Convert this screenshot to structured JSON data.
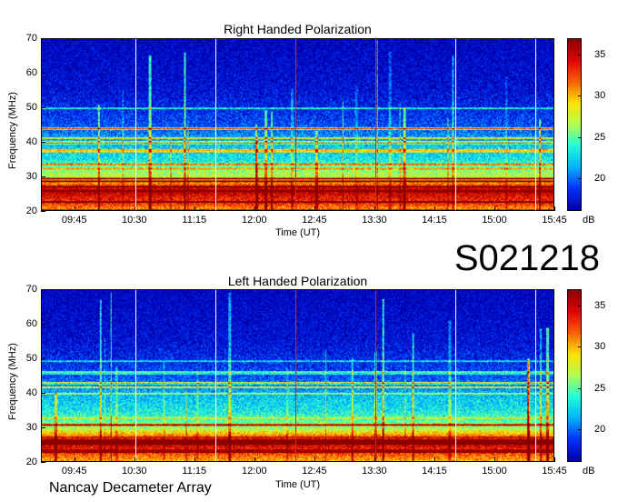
{
  "session_id": "S021218",
  "footer_text": "Nancay Decameter Array",
  "colors": {
    "background_blue": "#0a1f9c",
    "marker_white": "#ffffff",
    "marker_red": "#d12a1a",
    "colormap": [
      "#0000aa",
      "#0030ff",
      "#00b0ff",
      "#20ffd8",
      "#b0ff50",
      "#ffe000",
      "#ff6000",
      "#e00000",
      "#8a0000"
    ]
  },
  "chart_data": [
    {
      "type": "heatmap",
      "title": "Right Handed Polarization",
      "xlabel": "Time (UT)",
      "ylabel": "Frequency (MHz)",
      "xlim": [
        "09:20",
        "15:45"
      ],
      "ylim": [
        20,
        70
      ],
      "x_ticks": [
        "09:45",
        "10:30",
        "11:15",
        "12:00",
        "12:45",
        "13:30",
        "14:15",
        "15:00",
        "15:45"
      ],
      "y_ticks": [
        20,
        30,
        40,
        50,
        60,
        70
      ],
      "colorbar": {
        "unit": "dB",
        "ticks": [
          20,
          25,
          30,
          35
        ],
        "range": [
          16,
          37
        ]
      },
      "time_markers": [
        {
          "time": "10:30",
          "color": "white"
        },
        {
          "time": "11:30",
          "color": "white"
        },
        {
          "time": "12:30",
          "color": "red"
        },
        {
          "time": "13:30",
          "color": "red"
        },
        {
          "time": "14:30",
          "color": "white"
        },
        {
          "time": "15:30",
          "color": "white"
        }
      ],
      "intensity_profile": [
        {
          "freq_mhz": 20,
          "db": 30
        },
        {
          "freq_mhz": 22,
          "db": 33
        },
        {
          "freq_mhz": 24,
          "db": 34
        },
        {
          "freq_mhz": 26,
          "db": 36
        },
        {
          "freq_mhz": 28,
          "db": 31
        },
        {
          "freq_mhz": 30,
          "db": 27
        },
        {
          "freq_mhz": 32,
          "db": 26
        },
        {
          "freq_mhz": 35,
          "db": 23
        },
        {
          "freq_mhz": 39,
          "db": 22
        },
        {
          "freq_mhz": 45,
          "db": 19
        },
        {
          "freq_mhz": 55,
          "db": 17
        },
        {
          "freq_mhz": 70,
          "db": 16
        }
      ]
    },
    {
      "type": "heatmap",
      "title": "Left Handed Polarization",
      "xlabel": "Time (UT)",
      "ylabel": "Frequency (MHz)",
      "xlim": [
        "09:20",
        "15:45"
      ],
      "ylim": [
        20,
        70
      ],
      "x_ticks": [
        "09:45",
        "10:30",
        "11:15",
        "12:00",
        "12:45",
        "13:30",
        "14:15",
        "15:00",
        "15:45"
      ],
      "y_ticks": [
        20,
        30,
        40,
        50,
        60,
        70
      ],
      "colorbar": {
        "unit": "dB",
        "ticks": [
          20,
          25,
          30,
          35
        ],
        "range": [
          16,
          37
        ]
      },
      "time_markers": [
        {
          "time": "10:30",
          "color": "white"
        },
        {
          "time": "11:30",
          "color": "white"
        },
        {
          "time": "12:30",
          "color": "red"
        },
        {
          "time": "13:30",
          "color": "red"
        },
        {
          "time": "14:30",
          "color": "white"
        },
        {
          "time": "15:30",
          "color": "white"
        }
      ],
      "intensity_profile": [
        {
          "freq_mhz": 20,
          "db": 30
        },
        {
          "freq_mhz": 22,
          "db": 32
        },
        {
          "freq_mhz": 24,
          "db": 34
        },
        {
          "freq_mhz": 26,
          "db": 36
        },
        {
          "freq_mhz": 28,
          "db": 30
        },
        {
          "freq_mhz": 30,
          "db": 26
        },
        {
          "freq_mhz": 32,
          "db": 25
        },
        {
          "freq_mhz": 35,
          "db": 23
        },
        {
          "freq_mhz": 39,
          "db": 22
        },
        {
          "freq_mhz": 45,
          "db": 19
        },
        {
          "freq_mhz": 55,
          "db": 17
        },
        {
          "freq_mhz": 70,
          "db": 16
        }
      ]
    }
  ]
}
